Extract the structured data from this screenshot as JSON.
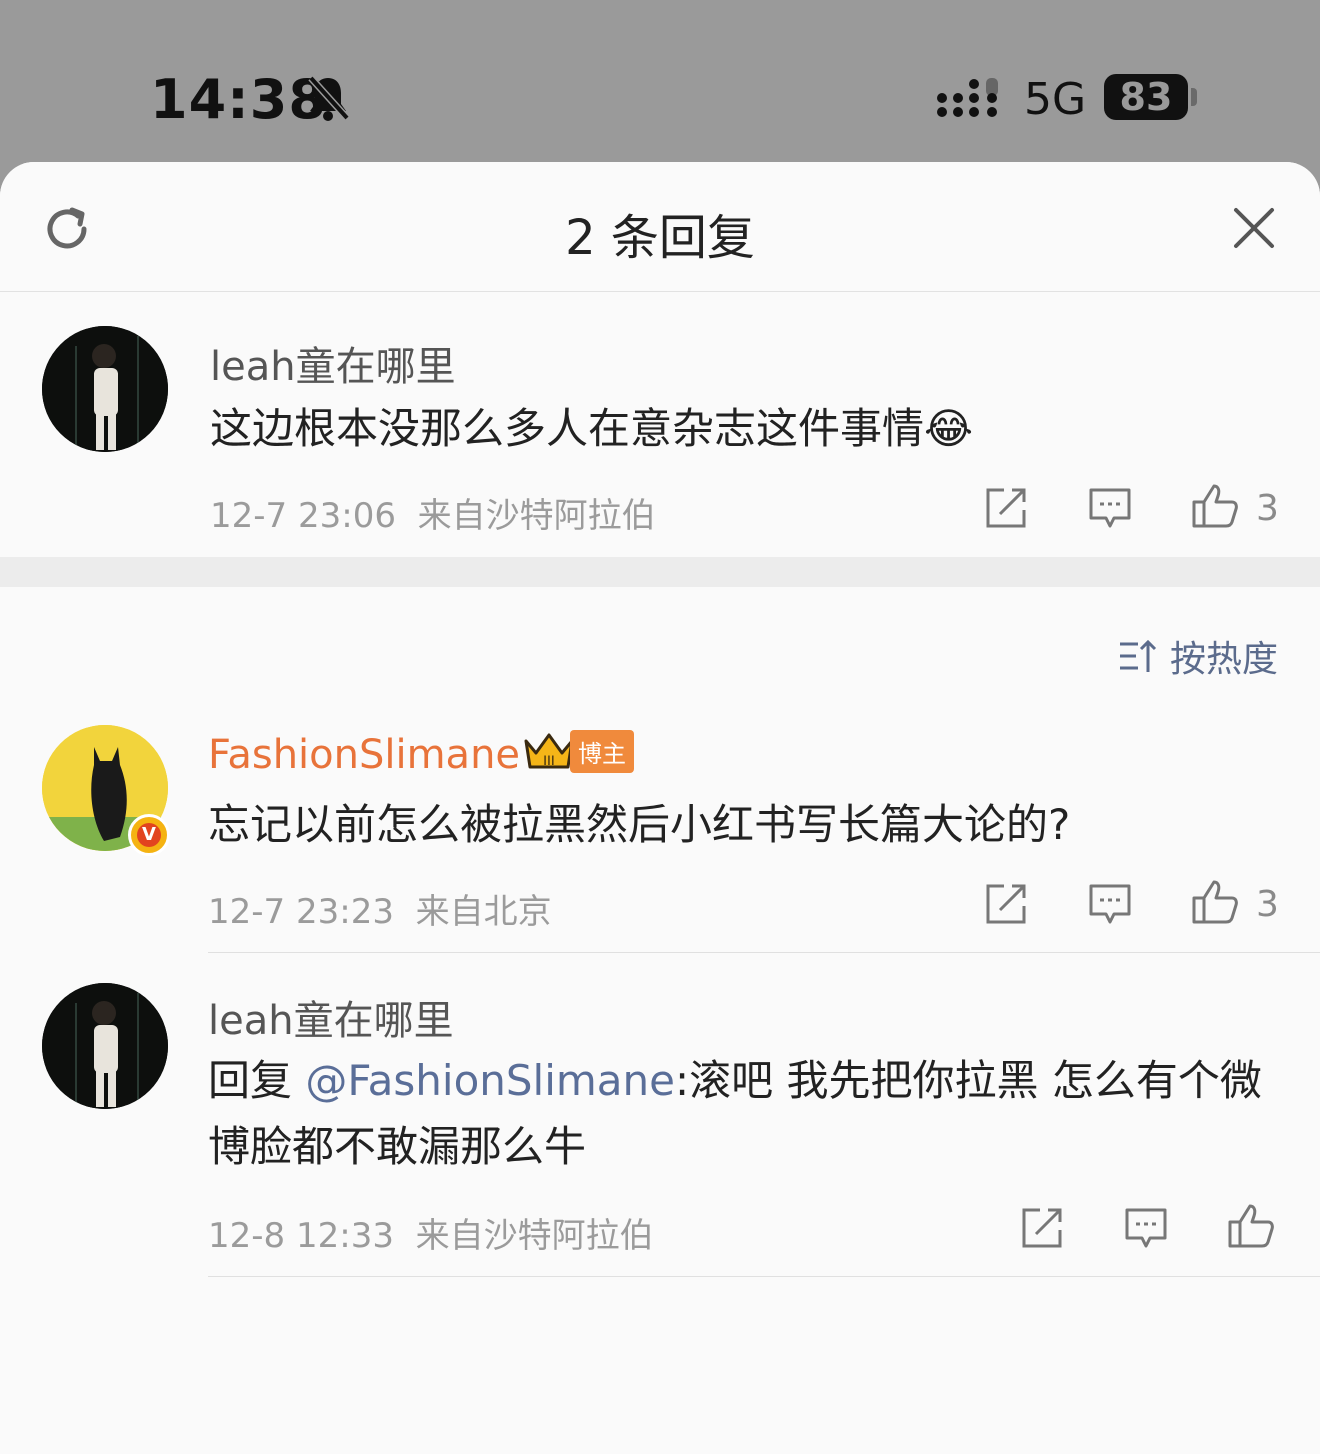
{
  "status_bar": {
    "time": "14:38",
    "network": "5G",
    "battery": "83"
  },
  "sheet": {
    "title": "2 条回复"
  },
  "root_comment": {
    "author": "leah童在哪里",
    "text": "这边根本没那么多人在意杂志这件事情",
    "emoji": "😂",
    "time": "12-7 23:06",
    "location": "来自沙特阿拉伯",
    "likes": "3"
  },
  "sort": {
    "label": "按热度"
  },
  "replies": [
    {
      "author": "FashionSlimane",
      "badge": "博主",
      "badge_level": "III",
      "verified_mark": "V",
      "text": "忘记以前怎么被拉黑然后小红书写长篇大论的?",
      "time": "12-7 23:23",
      "location": "来自北京",
      "likes": "3"
    },
    {
      "author": "leah童在哪里",
      "reply_prefix": "回复 ",
      "mention": "@FashionSlimane",
      "text_line1": ":滚吧 我先把你拉黑 怎么有个微",
      "text_line2": "博脸都不敢漏那么牛",
      "time": "12-8 12:33",
      "location": "来自沙特阿拉伯"
    }
  ],
  "colors": {
    "status_bg": "#9a9a9a",
    "sheet_bg": "#fafafa",
    "vip_name": "#e8733a",
    "mention": "#5a6e98",
    "meta": "#9b9b9b"
  }
}
